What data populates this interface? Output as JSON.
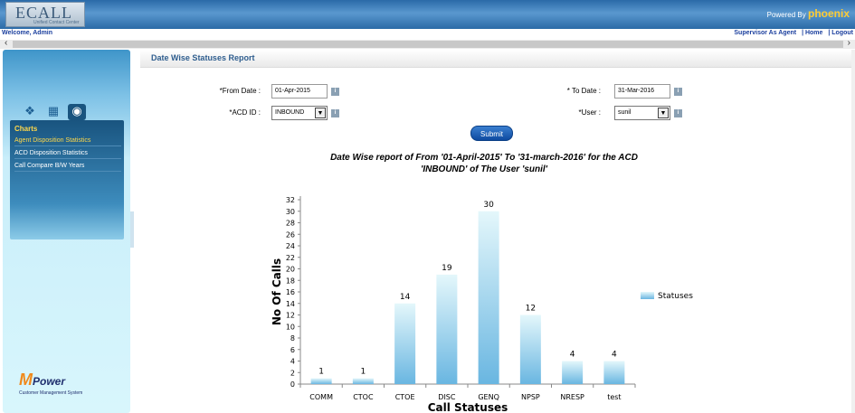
{
  "header": {
    "logo_text": "ECALL",
    "logo_sub": "Unified Contact Center",
    "powered_by": "Powered By",
    "powered_brand": "phoenix"
  },
  "welcome": {
    "text": "Welcome,  Admin"
  },
  "top_links": [
    "Supervisor As Agent",
    "| Home",
    "| Logout"
  ],
  "sidebar": {
    "section_title": "Charts",
    "items": [
      "Agent Disposition Statistics",
      "ACD Disposition Statistics",
      "Call Compare B/W Years"
    ],
    "brand_name": "Power",
    "brand_sub": "Customer Management System"
  },
  "page": {
    "title": "Date Wise Statuses Report"
  },
  "form": {
    "from_label": "*From Date :",
    "from_value": "01-Apr-2015",
    "to_label": "* To Date :",
    "to_value": "31-Mar-2016",
    "acd_label": "*ACD ID :",
    "acd_value": "INBOUND",
    "user_label": "*User :",
    "user_value": "sunil",
    "submit_label": "Submit"
  },
  "chart_data": {
    "type": "bar",
    "title_line1": "Date Wise report of  From '01-April-2015' To '31-march-2016' for the ACD",
    "title_line2": "'INBOUND' of The User 'sunil'",
    "categories": [
      "COMM",
      "CTOC",
      "CTOE",
      "DISC",
      "GENQ",
      "NPSP",
      "NRESP",
      "test"
    ],
    "series": [
      {
        "name": "Statuses",
        "values": [
          1,
          1,
          14,
          19,
          30,
          12,
          4,
          4
        ]
      }
    ],
    "xlabel": "Call Statuses",
    "ylabel": "No Of Calls",
    "ylim": [
      0,
      32
    ],
    "yticks": [
      0,
      2,
      4,
      6,
      8,
      10,
      12,
      14,
      16,
      18,
      20,
      22,
      24,
      26,
      28,
      30,
      32
    ],
    "legend": "right",
    "bar_color_top": "#e4f7fb",
    "bar_color_bottom": "#69b6e1"
  }
}
